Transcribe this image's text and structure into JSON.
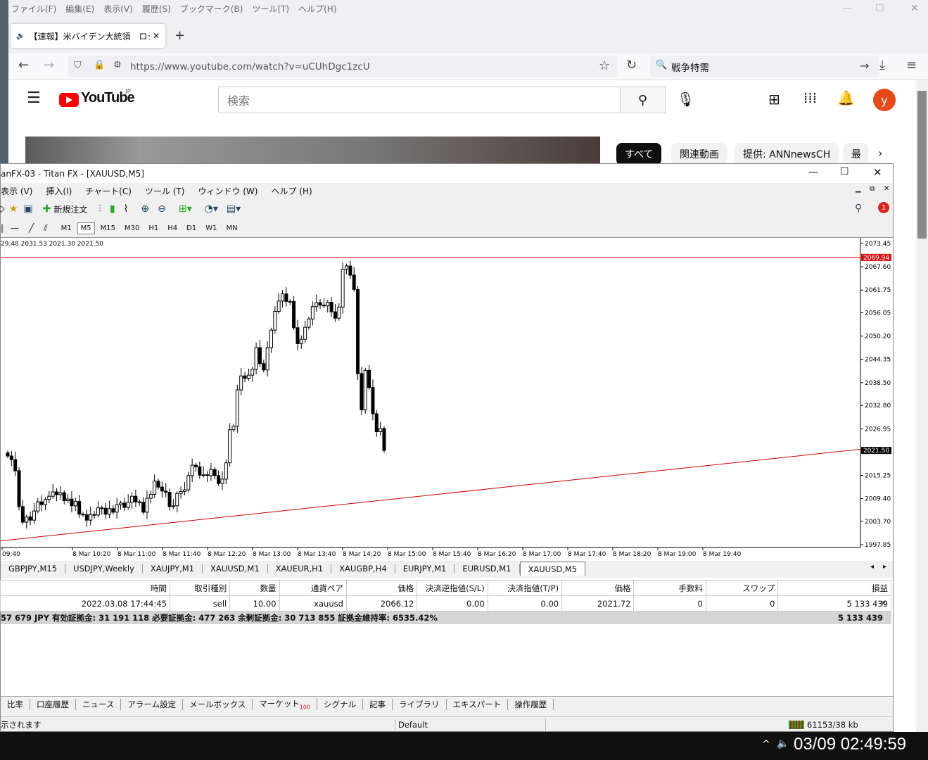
{
  "browser": {
    "menu": [
      "ファイル(F)",
      "編集(E)",
      "表示(V)",
      "履歴(S)",
      "ブックマーク(B)",
      "ツール(T)",
      "ヘルプ(H)"
    ],
    "tab_title": "【速報】米バイデン大統領　ロシア産",
    "url": "https://www.youtube.com/watch?v=uCUhDgc1zcU",
    "search_query": "戦争特需"
  },
  "youtube": {
    "logo": "YouTube",
    "region": "JP",
    "search_placeholder": "検索",
    "avatar_letter": "y",
    "chips": [
      "すべて",
      "関連動画",
      "提供: ANNnewsCH",
      "最"
    ]
  },
  "mt4": {
    "title": "anFX-03 - Titan FX - [XAUUSD,M5]",
    "menu": [
      "表示 (V)",
      "挿入(I)",
      "チャート(C)",
      "ツール (T)",
      "ウィンドウ (W)",
      "ヘルプ (H)"
    ],
    "new_order": "新規注文",
    "timeframes": [
      "M1",
      "M5",
      "M15",
      "M30",
      "H1",
      "H4",
      "D1",
      "W1",
      "MN"
    ],
    "active_timeframe": "M5",
    "alert_count": "1",
    "ohlc_label": "29.48 2031.53 2021.30 2021.50",
    "chart_tabs": [
      "GBPJPY,M15",
      "USDJPY,Weekly",
      "XAUJPY,M1",
      "XAUUSD,M1",
      "XAUEUR,H1",
      "XAUGBP,H4",
      "EURJPY,M1",
      "EURUSD,M1",
      "XAUUSD,M5"
    ],
    "active_chart_tab": "XAUUSD,M5",
    "terminal": {
      "headers": [
        "時間",
        "取引種別",
        "数量",
        "通貨ペア",
        "価格",
        "決済逆指値(S/L)",
        "決済指値(T/P)",
        "価格",
        "手数料",
        "スワップ",
        "損益"
      ],
      "row": [
        "2022.03.08 17:44:45",
        "sell",
        "10.00",
        "xauusd",
        "2066.12",
        "0.00",
        "0.00",
        "2021.72",
        "0",
        "0",
        "5 133 439"
      ],
      "balance_line": "57 679 JPY  有効証拠金: 31 191 118  必要証拠金: 477 263  余剰証拠金: 30 713 855  証拠金維持率: 6535.42%",
      "balance_profit": "5 133 439"
    },
    "terminal_tabs": [
      "比率",
      "口座履歴",
      "ニュース",
      "アラーム設定",
      "メールボックス",
      "マーケット",
      "シグナル",
      "記事",
      "ライブラリ",
      "エキスパート",
      "操作履歴"
    ],
    "market_badge": "100",
    "status_left": "示されます",
    "status_profile": "Default",
    "status_traffic": "61153/38 kb"
  },
  "taskbar": {
    "clock": "03/09 02:49:59"
  },
  "chart_data": {
    "type": "candlestick",
    "symbol": "XAUUSD,M5",
    "y_ticks": [
      2073.45,
      2067.6,
      2061.75,
      2056.05,
      2050.2,
      2044.35,
      2038.5,
      2032.8,
      2026.95,
      2021.5,
      2015.25,
      2009.4,
      2003.7,
      1997.85
    ],
    "ylim": [
      1997.85,
      2073.45
    ],
    "x_ticks": [
      "09:40",
      "8 Mar 10:20",
      "8 Mar 11:00",
      "8 Mar 11:40",
      "8 Mar 12:20",
      "8 Mar 13:00",
      "8 Mar 13:40",
      "8 Mar 14:20",
      "8 Mar 15:00",
      "8 Mar 15:40",
      "8 Mar 16:20",
      "8 Mar 17:00",
      "8 Mar 17:40",
      "8 Mar 18:20",
      "8 Mar 19:00",
      "8 Mar 19:40"
    ],
    "price_line": 2069.94,
    "price_line_label": "2069.94",
    "current_price": 2021.5,
    "current_price_label": "2021.50",
    "closes": [
      2020.1,
      2019.2,
      2016.4,
      2007.4,
      2003.5,
      2004.8,
      2004.0,
      2006.3,
      2008.6,
      2007.9,
      2009.2,
      2010.0,
      2011.1,
      2010.4,
      2010.9,
      2008.9,
      2009.3,
      2007.6,
      2008.7,
      2005.5,
      2005.4,
      2004.0,
      2005.4,
      2005.3,
      2007.1,
      2007.0,
      2005.5,
      2006.9,
      2006.0,
      2007.9,
      2008.3,
      2007.2,
      2008.5,
      2010.0,
      2008.6,
      2008.5,
      2006.0,
      2009.5,
      2010.5,
      2013.8,
      2012.3,
      2011.3,
      2011.0,
      2007.4,
      2007.6,
      2010.7,
      2011.2,
      2011.6,
      2015.2,
      2017.8,
      2017.4,
      2015.3,
      2015.4,
      2015.2,
      2016.7,
      2015.2,
      2013.2,
      2014.3,
      2018.4,
      2026.7,
      2027.6,
      2036.7,
      2040.2,
      2039.6,
      2040.4,
      2041.9,
      2047.3,
      2043.3,
      2041.7,
      2047.3,
      2051.7,
      2056.4,
      2059.0,
      2060.8,
      2058.9,
      2058.9,
      2052.3,
      2048.3,
      2049.4,
      2052.4,
      2054.5,
      2057.6,
      2058.6,
      2058.0,
      2057.8,
      2058.7,
      2056.3,
      2054.7,
      2057.5,
      2067.0,
      2067.8,
      2065.5,
      2061.9,
      2040.8,
      2031.7,
      2041.6,
      2037.3,
      2030.7,
      2026.2,
      2027.0,
      2021.5
    ]
  }
}
